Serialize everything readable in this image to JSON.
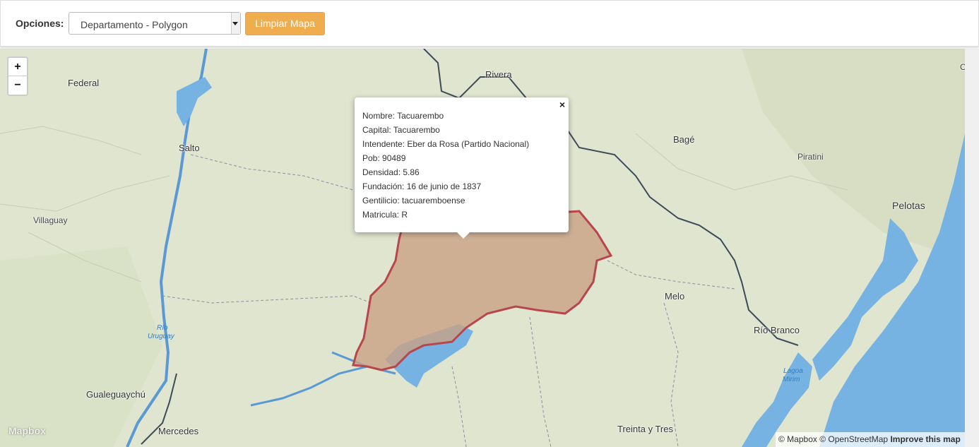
{
  "toolbar": {
    "options_label": "Opciones:",
    "select_value": "Departamento - Polygon",
    "clear_button": "Limpiar Mapa"
  },
  "map": {
    "zoom_in": "+",
    "zoom_out": "−",
    "labels": {
      "federal": "Federal",
      "rivera": "Rivera",
      "salto": "Salto",
      "bage": "Bagé",
      "piratini": "Piratini",
      "pelotas": "Pelotas",
      "villaguay": "Villaguay",
      "melo": "Melo",
      "rio_branco": "Río Branco",
      "gualeguaychu": "Gualeguaychú",
      "mercedes": "Mercedes",
      "treinta_y_tres": "Treinta y Tres",
      "rio_uruguay_1": "Río",
      "rio_uruguay_2": "Uruguay",
      "lagoa_1": "Lagoa",
      "lagoa_2": "Mirim",
      "edge_c": "C"
    },
    "logo": "Mapbox",
    "attribution": {
      "mapbox": "© Mapbox",
      "osm": "© OpenStreetMap",
      "improve": "Improve this map"
    },
    "colors": {
      "land": "#dfe5cf",
      "water": "#76b3e3",
      "polygon_fill": "#c9a184",
      "polygon_stroke": "#b8464b"
    }
  },
  "popup": {
    "close": "×",
    "lines": [
      "Nombre: Tacuarembo",
      "Capital: Tacuarembo",
      "Intendente: Eber da Rosa (Partido Nacional)",
      "Pob: 90489",
      "Densidad: 5.86",
      "Fundación: 16 de junio de 1837",
      "Gentilicio: tacuaremboense",
      "Matricula: R"
    ]
  }
}
